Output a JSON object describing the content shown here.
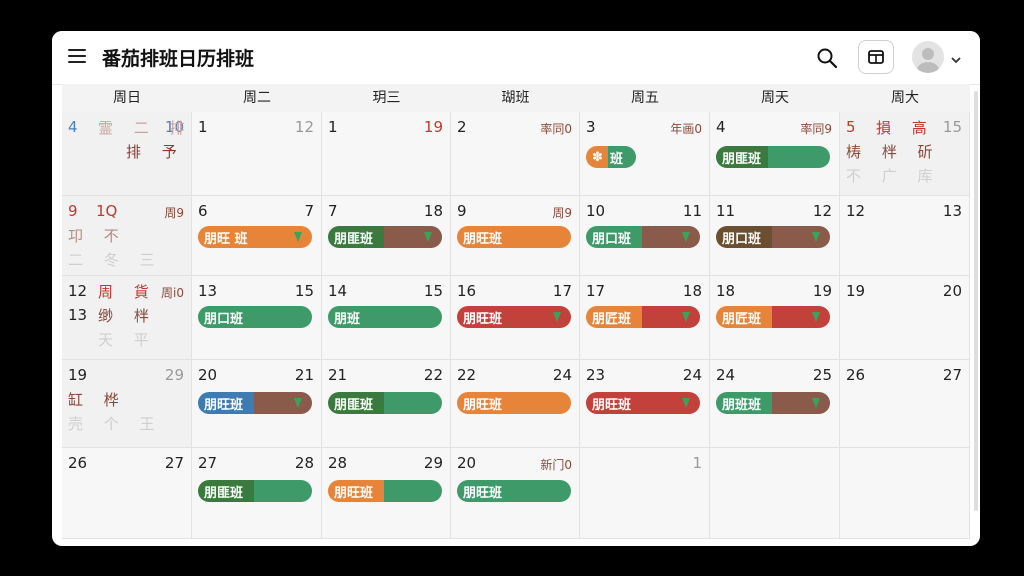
{
  "app": {
    "title": "番茄排班日历排班"
  },
  "weekdays": [
    "周日",
    "周二",
    "玥三",
    "瑚班",
    "周五",
    "周天",
    "周大"
  ],
  "week1": {
    "sun": {
      "d1": "4",
      "d2": "10",
      "faint1": "霊 二 排",
      "faint2": "排 予"
    },
    "mon": {
      "d1": "1",
      "d2": "12"
    },
    "tue": {
      "d1": "1",
      "d2": "19"
    },
    "wed": {
      "d1": "2",
      "sub": "率同0"
    },
    "thu": {
      "d1": "3",
      "sub": "年画0",
      "pill": "班"
    },
    "fri": {
      "d1": "4",
      "sub": "率同9",
      "pill": "朋匪班"
    },
    "sat": {
      "d1": "5",
      "d2": "15",
      "faint1": "損 高",
      "faint2": "梼 柈 斫",
      "faint3": "不 广 库"
    }
  },
  "week2": {
    "sun": {
      "d1": "9",
      "d1b": "1Q",
      "sub": "周9",
      "faint1": "卭 不",
      "faint2": "二 冬 三"
    },
    "mon": {
      "d1": "6",
      "d2": "7",
      "pill": "朋旺 班"
    },
    "tue": {
      "d1": "7",
      "d2": "18",
      "pill": "朋匪班"
    },
    "wed": {
      "d1": "9",
      "sub": "周9",
      "pill": "朋旺班"
    },
    "thu": {
      "d1": "10",
      "d2": "11",
      "pill": "朋口班"
    },
    "fri": {
      "d1": "11",
      "d2": "12",
      "pill": "朋口班"
    },
    "sat": {
      "d1": "12",
      "d2": "13"
    }
  },
  "week3": {
    "sun": {
      "d1": "12",
      "faint0": "周 貨",
      "sub": "周i0",
      "d3": "13",
      "faint1": "缈 柈",
      "faint2": "天 平"
    },
    "mon": {
      "d1": "13",
      "d2": "15",
      "pill": "朋口班"
    },
    "tue": {
      "d1": "14",
      "d2": "15",
      "pill": "朋班"
    },
    "wed": {
      "d1": "16",
      "d2": "17",
      "pill": "朋旺班"
    },
    "thu": {
      "d1": "17",
      "d2": "18",
      "pill": "朋匠班"
    },
    "fri": {
      "d1": "18",
      "d2": "19",
      "pill": "朋匠班"
    },
    "sat": {
      "d1": "19",
      "d2": "20"
    }
  },
  "week4": {
    "sun": {
      "d1": "19",
      "d2": "29",
      "faint1": "缸 桦",
      "faint2": "壳 个 王"
    },
    "mon": {
      "d1": "20",
      "d2": "21",
      "pill": "朋旺班"
    },
    "tue": {
      "d1": "21",
      "d2": "22",
      "pill": "朋匪班"
    },
    "wed": {
      "d1": "22",
      "d2": "24",
      "pill": "朋旺班"
    },
    "thu": {
      "d1": "23",
      "d2": "24",
      "pill": "朋旺班"
    },
    "fri": {
      "d1": "24",
      "d2": "25",
      "pill": "朋班班"
    },
    "sat": {
      "d1": "26",
      "d2": "27"
    }
  },
  "week5": {
    "sun": {
      "d1": "26",
      "d2": "27"
    },
    "mon": {
      "d1": "27",
      "d2": "28",
      "pill": "朋匪班"
    },
    "tue": {
      "d1": "28",
      "d2": "29",
      "pill": "朋旺班"
    },
    "wed": {
      "d1": "20",
      "sub": "新门0",
      "pill": "朋旺班"
    },
    "thu": {
      "d2": "1"
    }
  },
  "colors": {
    "orange": "#e6843a",
    "green": "#3f9a6a",
    "darkgreen": "#3b7a3e",
    "brown": "#8a5a4a",
    "red": "#c2413a",
    "blue": "#3e7bb0"
  }
}
